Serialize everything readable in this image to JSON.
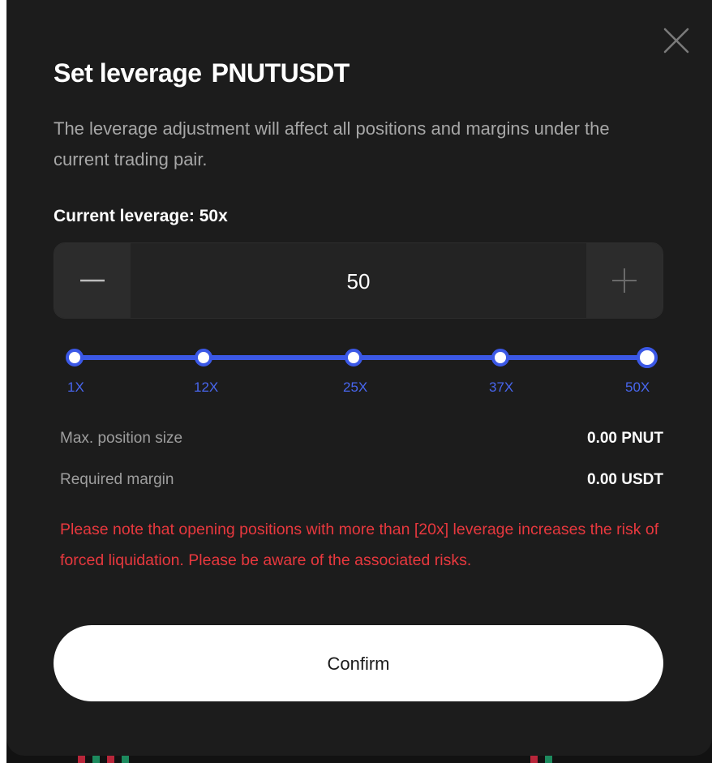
{
  "dialog": {
    "title": "Set leverage",
    "pair": "PNUTUSDT",
    "description": "The leverage adjustment will affect all positions and margins under the current trading pair.",
    "current_leverage_label": "Current leverage: 50x",
    "stepper": {
      "value": "50"
    },
    "slider": {
      "ticks": [
        "1X",
        "12X",
        "25X",
        "37X",
        "50X"
      ],
      "selected": "50X",
      "fill_fraction": 1.0
    },
    "info": {
      "max_position_label": "Max. position size",
      "max_position_value": "0.00 PNUT",
      "required_margin_label": "Required margin",
      "required_margin_value": "0.00 USDT"
    },
    "warning": "Please note that opening positions with more than [20x] leverage increases the risk of forced liquidation. Please be aware of the associated risks.",
    "confirm_label": "Confirm"
  },
  "icons": {
    "close": "close-icon",
    "minus": "minus-icon",
    "plus": "plus-icon"
  },
  "colors": {
    "modal_bg": "#1c1c1c",
    "accent": "#3b58e6",
    "warning": "#e8383e",
    "confirm_bg": "#ffffff"
  }
}
